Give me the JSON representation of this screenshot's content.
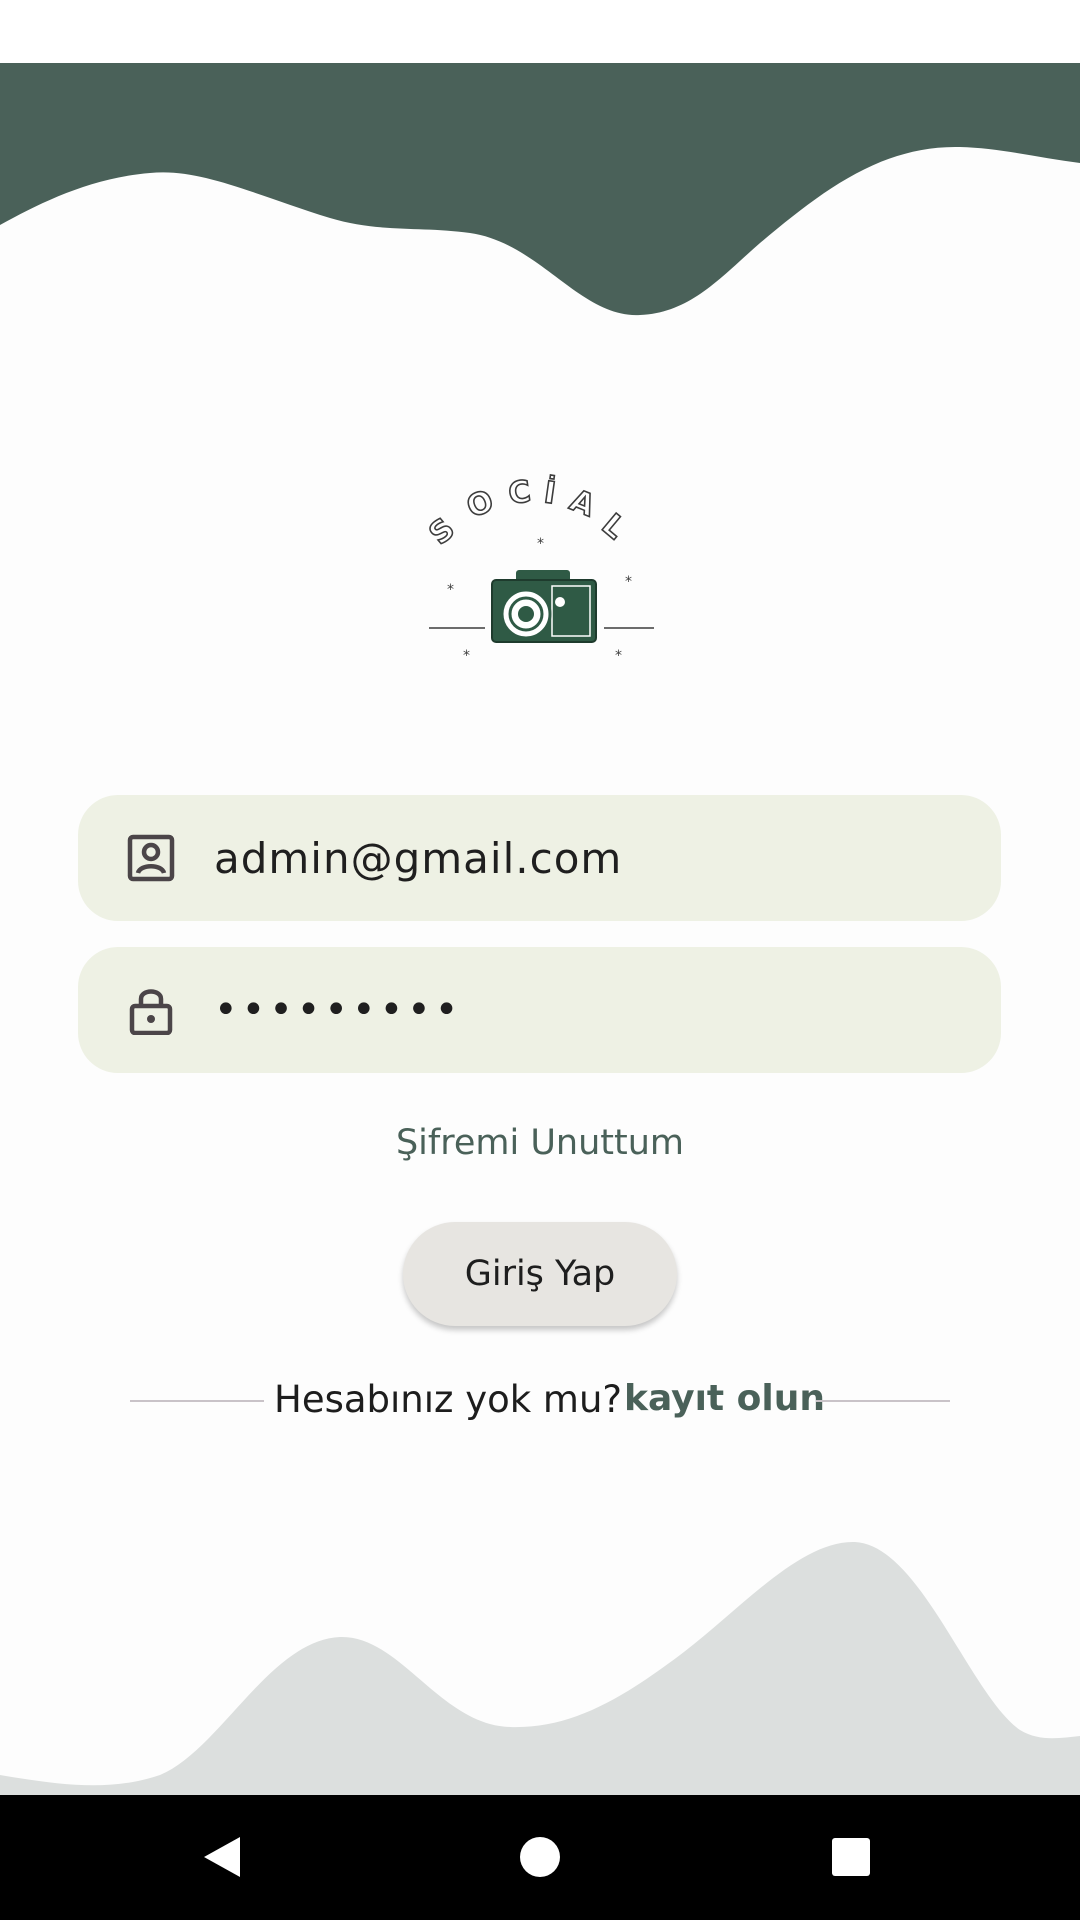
{
  "colors": {
    "accent": "#4a6159",
    "field_background": "#eef1e4",
    "button_background": "#e7e5e1",
    "top_wave": "#4a6159",
    "bottom_wave": "#dcdfde"
  },
  "logo": {
    "text": "SOCIAL"
  },
  "login_form": {
    "email": {
      "icon": "account-box-icon",
      "value": "admin@gmail.com"
    },
    "password": {
      "icon": "lock-icon",
      "value": "•••••••••"
    },
    "forgot_password": "Şifremi Unuttum",
    "submit_label": "Giriş Yap"
  },
  "signup": {
    "prompt": "Hesabınız yok mu?",
    "link": "kayıt olun"
  },
  "nav_bar": {
    "back_icon": "back-triangle-icon",
    "home_icon": "home-circle-icon",
    "recents_icon": "recents-square-icon"
  }
}
